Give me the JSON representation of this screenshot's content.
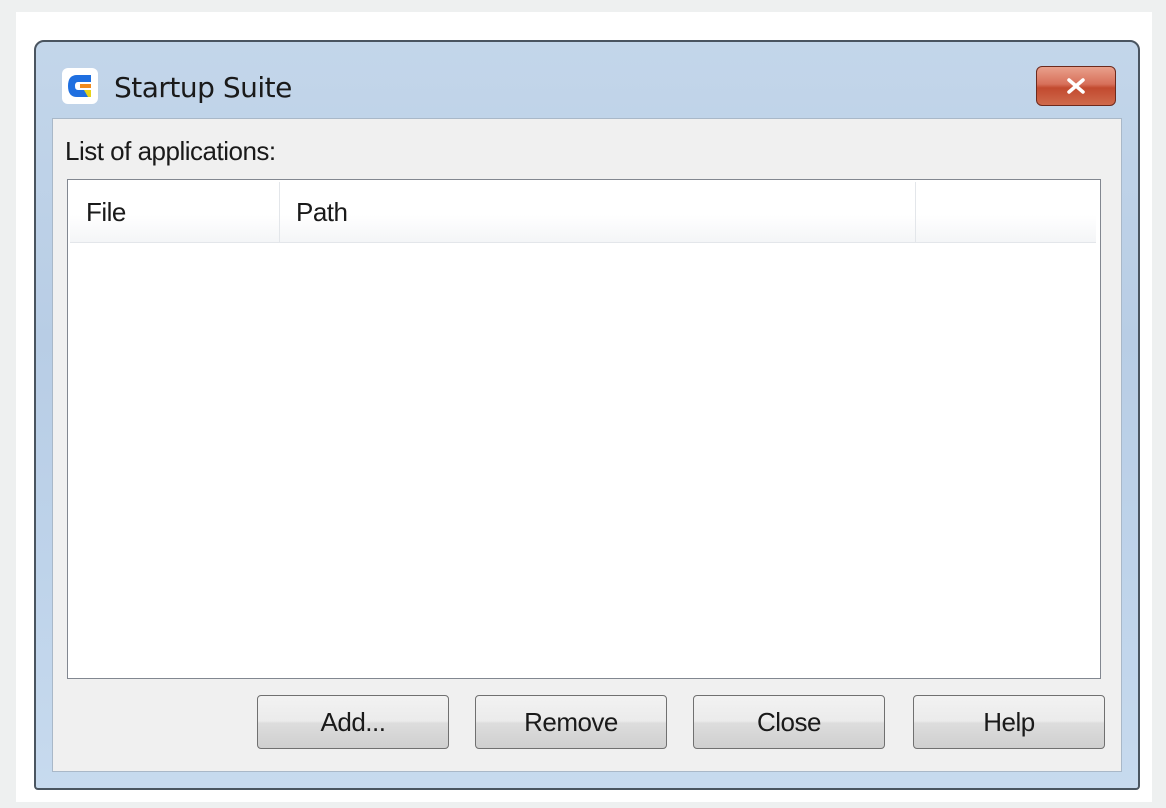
{
  "window": {
    "title": "Startup Suite",
    "icon": "startup-suite-app-icon",
    "close_icon": "close-x-icon"
  },
  "main": {
    "list_label": "List of applications:",
    "columns": [
      "File",
      "Path",
      ""
    ],
    "rows": []
  },
  "buttons": {
    "add": "Add...",
    "remove": "Remove",
    "close": "Close",
    "help": "Help"
  },
  "colors": {
    "frame": "#c3d6ea",
    "client": "#f0f0f0",
    "close_button": "#c24a2f",
    "icon_blue": "#1f6fe0",
    "icon_orange": "#f08a1c"
  }
}
